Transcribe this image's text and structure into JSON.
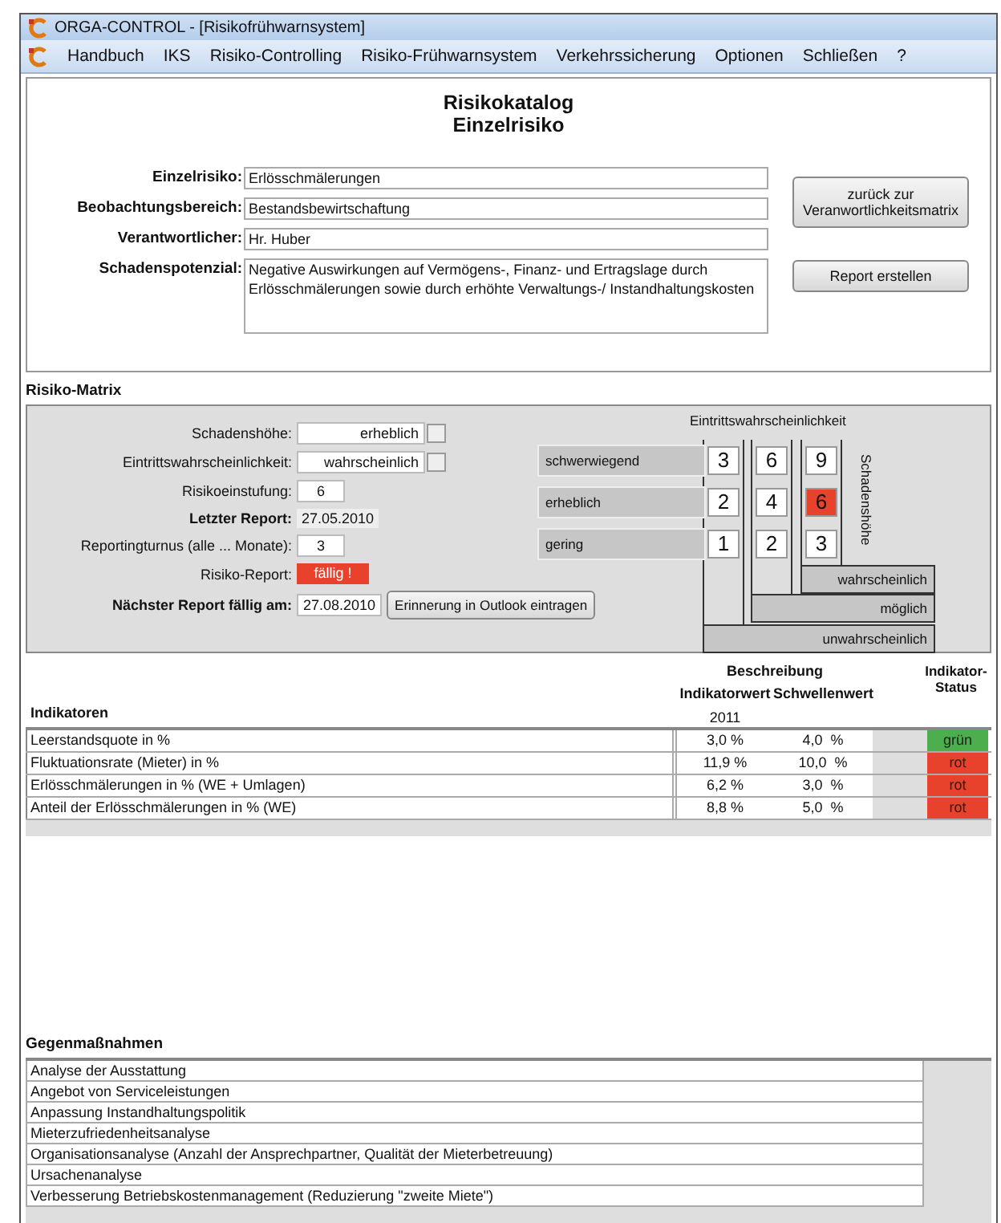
{
  "window": {
    "title": "ORGA-CONTROL - [Risikofrühwarnsystem]"
  },
  "menu": [
    "Handbuch",
    "IKS",
    "Risiko-Controlling",
    "Risiko-Frühwarnsystem",
    "Verkehrssicherung",
    "Optionen",
    "Schließen",
    "?"
  ],
  "header": {
    "title": "Risikokatalog",
    "subtitle": "Einzelrisiko"
  },
  "fields": [
    {
      "kind": "single",
      "label": "Einzelrisiko:",
      "value": "Erlösschmälerungen"
    },
    {
      "kind": "single",
      "label": "Beobachtungsbereich:",
      "value": "Bestandsbewirtschaftung"
    },
    {
      "kind": "single",
      "label": "Verantwortlicher:",
      "value": "Hr. Huber"
    },
    {
      "kind": "multiline",
      "label": "Schadenspotenzial:",
      "value": "Negative Auswirkungen auf Vermögens-, Finanz- und Ertragslage durch Erlösschmälerungen sowie durch erhöhte Verwaltungs-/ Instandhaltungskosten"
    }
  ],
  "buttons": [
    "zurück zur Veranwortlichkeitsmatrix",
    "Report erstellen"
  ],
  "risk_matrix": {
    "title": "Risiko-Matrix",
    "form": [
      {
        "kind": "select",
        "label": "Schadenshöhe:",
        "value": "erheblich"
      },
      {
        "kind": "select",
        "label": "Eintrittswahrscheinlichkeit:",
        "value": "wahrscheinlich"
      },
      {
        "kind": "input",
        "label": "Risikoeinstufung:",
        "value": "6"
      },
      {
        "kind": "info",
        "label": "Letzter Report:",
        "value": "27.05.2010"
      },
      {
        "kind": "input",
        "label": "Reportingturnus (alle ... Monate):",
        "value": "3"
      },
      {
        "kind": "status",
        "label": "Risiko-Report:",
        "value": "fällig !",
        "color": "#e8412c"
      },
      {
        "kind": "due",
        "label": "Nächster Report fällig am:",
        "value": "27.08.2010",
        "button": "Erinnerung in Outlook eintragen"
      }
    ],
    "matrix": {
      "column_heading": "Eintrittswahrscheinlichkeit",
      "row_heading": "Schadenshöhe",
      "damage_levels": [
        {
          "label": "schwerwiegend",
          "scores": [
            {
              "value": "3",
              "selected": false
            },
            {
              "value": "6",
              "selected": false
            },
            {
              "value": "9",
              "selected": false
            }
          ]
        },
        {
          "label": "erheblich",
          "scores": [
            {
              "value": "2",
              "selected": false
            },
            {
              "value": "4",
              "selected": false
            },
            {
              "value": "6",
              "selected": true
            }
          ]
        },
        {
          "label": "gering",
          "scores": [
            {
              "value": "1",
              "selected": false
            },
            {
              "value": "2",
              "selected": false
            },
            {
              "value": "3",
              "selected": false
            }
          ]
        }
      ],
      "probability_levels": [
        "wahrscheinlich",
        "möglich",
        "unwahrscheinlich"
      ]
    }
  },
  "indicators": {
    "title": "Indikatoren",
    "group_heading": "Beschreibung",
    "value_heading": "Indikatorwert",
    "year": "2011",
    "threshold_heading": "Schwellenwert",
    "status_heading": "Indikator-Status",
    "rows": [
      {
        "name": "Leerstandsquote in %",
        "value": "3,0 %",
        "threshold": "4,0  %",
        "status": "grün",
        "color": "#4cae4c"
      },
      {
        "name": "Fluktuationsrate (Mieter) in %",
        "value": "11,9 %",
        "threshold": "10,0  %",
        "status": "rot",
        "color": "#e8412c"
      },
      {
        "name": "Erlösschmälerungen in % (WE + Umlagen)",
        "value": "6,2 %",
        "threshold": "3,0  %",
        "status": "rot",
        "color": "#e8412c"
      },
      {
        "name": "Anteil der Erlösschmälerungen in % (WE)",
        "value": "8,8 %",
        "threshold": "5,0  %",
        "status": "rot",
        "color": "#e8412c"
      }
    ]
  },
  "countermeasures": {
    "title": "Gegenmaßnahmen",
    "items": [
      "Analyse der Ausstattung",
      "Angebot von Serviceleistungen",
      "Anpassung Instandhaltungspolitik",
      "Mieterzufriedenheitsanalyse",
      "Organisationsanalyse (Anzahl der Ansprechpartner, Qualität der Mieterbetreuung)",
      "Ursachenanalyse",
      "Verbesserung Betriebskostenmanagement (Reduzierung \"zweite Miete\")"
    ]
  }
}
